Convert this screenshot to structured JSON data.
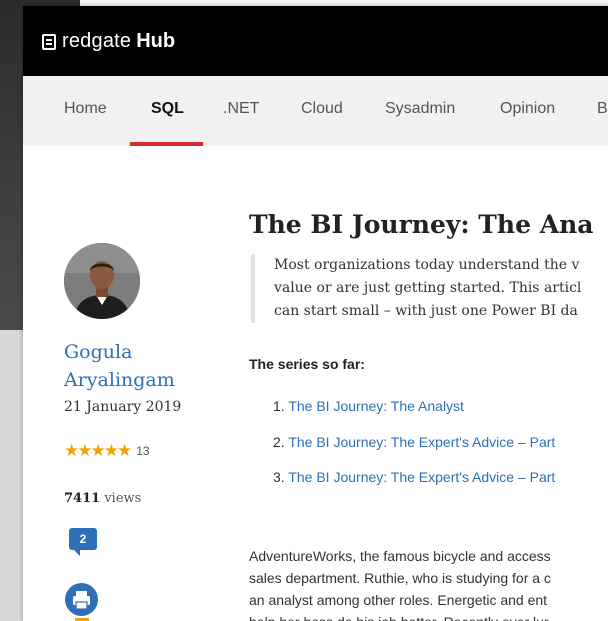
{
  "brand": {
    "name": "redgate",
    "product": "Hub",
    "accent": "#d52b2b",
    "link_color": "#2e6fb8",
    "star_color": "#f0a30a"
  },
  "nav": {
    "items": [
      {
        "label": "Home"
      },
      {
        "label": "SQL"
      },
      {
        "label": ".NET"
      },
      {
        "label": "Cloud"
      },
      {
        "label": "Sysadmin"
      },
      {
        "label": "Opinion"
      },
      {
        "label": "B"
      }
    ],
    "active": "SQL"
  },
  "author": {
    "first_name": "Gogula",
    "last_name": "Aryalingam",
    "date": "21 January 2019",
    "rating_stars": 5,
    "rating_count": "13",
    "views_number": "7411",
    "views_label": "views",
    "comments": "2"
  },
  "article": {
    "title": "The BI Journey: The Ana",
    "intro_lines": [
      "Most organizations today understand the v",
      "value or are just getting started. This articl",
      "can start small – with just one Power BI da"
    ],
    "series_label": "The series so far:",
    "series": [
      {
        "num": "1.",
        "text": "The BI Journey: The Analyst"
      },
      {
        "num": "2.",
        "text": "The BI Journey: The Expert's Advice – Part"
      },
      {
        "num": "3.",
        "text": "The BI Journey: The Expert's Advice – Part"
      }
    ],
    "body_lines": [
      "AdventureWorks, the famous bicycle and access",
      "sales department. Ruthie, who is studying for a c",
      "an analyst among other roles. Energetic and ent",
      "help her boss do his job better. Recently over lur"
    ]
  }
}
